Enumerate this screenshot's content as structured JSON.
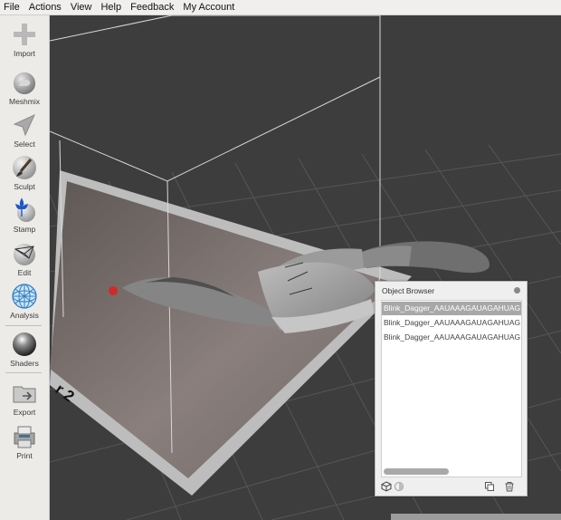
{
  "menu": [
    "File",
    "Actions",
    "View",
    "Help",
    "Feedback",
    "My Account"
  ],
  "tools": [
    {
      "label": "Import",
      "icon": "plus-icon"
    },
    {
      "label": "Meshmix",
      "icon": "meshmix-bunny-icon"
    },
    {
      "label": "Select",
      "icon": "arrow-cursor-icon"
    },
    {
      "label": "Sculpt",
      "icon": "brush-icon"
    },
    {
      "label": "Stamp",
      "icon": "stamp-fleur-icon"
    },
    {
      "label": "Edit",
      "icon": "edit-mesh-icon"
    },
    {
      "label": "Analysis",
      "icon": "analysis-sphere-icon"
    },
    {
      "label": "Shaders",
      "icon": "shader-sphere-icon"
    },
    {
      "label": "Export",
      "icon": "export-folder-icon"
    },
    {
      "label": "Print",
      "icon": "printer-icon"
    }
  ],
  "viewport": {
    "plate_label": "r 2"
  },
  "object_browser": {
    "title": "Object Browser",
    "items": [
      {
        "name": "Blink_Dagger_AAUAAAGAUAGAHUAG",
        "selected": true
      },
      {
        "name": "Blink_Dagger_AAUAAAGAUAGAHUAG",
        "selected": false
      },
      {
        "name": "Blink_Dagger_AAUAAAGAUAGAHUAG",
        "selected": false
      }
    ]
  },
  "colors": {
    "background": "#3d3d3d",
    "grid": "#5a5a5a",
    "plate_border": "#bdbdbd",
    "plate_inner": "#7a716e",
    "model": "#a9a9a9",
    "pivot": "#d02a2a",
    "selection_row": "#a8a8a8"
  }
}
